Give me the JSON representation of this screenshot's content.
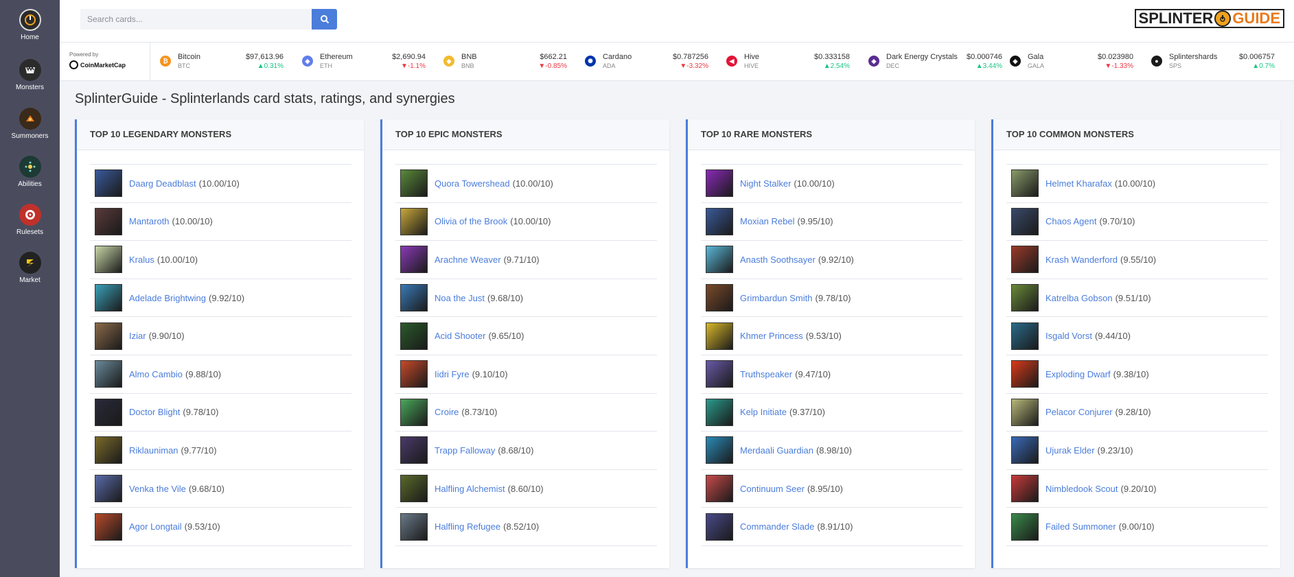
{
  "sidebar": {
    "items": [
      {
        "label": "Home",
        "icon": "home-icon",
        "color": "#2b2b2b"
      },
      {
        "label": "Monsters",
        "icon": "monster-icon",
        "color": "#2b2b2b"
      },
      {
        "label": "Summoners",
        "icon": "summoner-icon",
        "color": "#3a2a1a"
      },
      {
        "label": "Abilities",
        "icon": "abilities-icon",
        "color": "#1d3a35"
      },
      {
        "label": "Rulesets",
        "icon": "rulesets-icon",
        "color": "#c0312b"
      },
      {
        "label": "Market",
        "icon": "market-icon",
        "color": "#222222"
      }
    ]
  },
  "header": {
    "search_placeholder": "Search cards...",
    "logo_part1": "SPLINTER",
    "logo_part2": "GUIDE"
  },
  "ticker": {
    "powered_by": "Powered by",
    "provider": "CoinMarketCap",
    "coins": [
      {
        "name": "Bitcoin",
        "symbol": "BTC",
        "price": "$97,613.96",
        "change": "▲0.31%",
        "direction": "up",
        "color": "#f7931a",
        "glyph": "₿"
      },
      {
        "name": "Ethereum",
        "symbol": "ETH",
        "price": "$2,690.94",
        "change": "▼-1.1%",
        "direction": "down",
        "color": "#627eea",
        "glyph": "◆"
      },
      {
        "name": "BNB",
        "symbol": "BNB",
        "price": "$662.21",
        "change": "▼-0.85%",
        "direction": "down",
        "color": "#f3ba2f",
        "glyph": "◆"
      },
      {
        "name": "Cardano",
        "symbol": "ADA",
        "price": "$0.787256",
        "change": "▼-3.32%",
        "direction": "down",
        "color": "#0033ad",
        "glyph": "✺"
      },
      {
        "name": "Hive",
        "symbol": "HIVE",
        "price": "$0.333158",
        "change": "▲2.54%",
        "direction": "up",
        "color": "#e31337",
        "glyph": "◀"
      },
      {
        "name": "Dark Energy Crystals",
        "symbol": "DEC",
        "price": "$0.000746",
        "change": "▲3.44%",
        "direction": "up",
        "color": "#5a2d91",
        "glyph": "◆"
      },
      {
        "name": "Gala",
        "symbol": "GALA",
        "price": "$0.023980",
        "change": "▼-1.33%",
        "direction": "down",
        "color": "#111111",
        "glyph": "◈"
      },
      {
        "name": "Splintershards",
        "symbol": "SPS",
        "price": "$0.006757",
        "change": "▲0.7%",
        "direction": "up",
        "color": "#1a1a1a",
        "glyph": "●"
      }
    ]
  },
  "page": {
    "title": "SplinterGuide - Splinterlands card stats, ratings, and synergies"
  },
  "cards": [
    {
      "title": "TOP 10 LEGENDARY MONSTERS",
      "rows": [
        {
          "name": "Daarg Deadblast",
          "score": "(10.00/10)",
          "color": "#3a5a9a"
        },
        {
          "name": "Mantaroth",
          "score": "(10.00/10)",
          "color": "#5a3a3a"
        },
        {
          "name": "Kralus",
          "score": "(10.00/10)",
          "color": "#c9d6a8"
        },
        {
          "name": "Adelade Brightwing",
          "score": "(9.92/10)",
          "color": "#3aa0b8"
        },
        {
          "name": "Iziar",
          "score": "(9.90/10)",
          "color": "#8a6a4a"
        },
        {
          "name": "Almo Cambio",
          "score": "(9.88/10)",
          "color": "#6a8a9a"
        },
        {
          "name": "Doctor Blight",
          "score": "(9.78/10)",
          "color": "#2a2a3a"
        },
        {
          "name": "Riklauniman",
          "score": "(9.77/10)",
          "color": "#7a6a2a"
        },
        {
          "name": "Venka the Vile",
          "score": "(9.68/10)",
          "color": "#5a6aa8"
        },
        {
          "name": "Agor Longtail",
          "score": "(9.53/10)",
          "color": "#b84a2a"
        }
      ]
    },
    {
      "title": "TOP 10 EPIC MONSTERS",
      "rows": [
        {
          "name": "Quora Towershead",
          "score": "(10.00/10)",
          "color": "#5a8a3a"
        },
        {
          "name": "Olivia of the Brook",
          "score": "(10.00/10)",
          "color": "#c8a83a"
        },
        {
          "name": "Arachne Weaver",
          "score": "(9.71/10)",
          "color": "#8a3ab8"
        },
        {
          "name": "Noa the Just",
          "score": "(9.68/10)",
          "color": "#3a7ab8"
        },
        {
          "name": "Acid Shooter",
          "score": "(9.65/10)",
          "color": "#2a5a2a"
        },
        {
          "name": "Iidri Fyre",
          "score": "(9.10/10)",
          "color": "#c84a2a"
        },
        {
          "name": "Croire",
          "score": "(8.73/10)",
          "color": "#4aa85a"
        },
        {
          "name": "Trapp Falloway",
          "score": "(8.68/10)",
          "color": "#4a3a6a"
        },
        {
          "name": "Halfling Alchemist",
          "score": "(8.60/10)",
          "color": "#5a6a2a"
        },
        {
          "name": "Halfling Refugee",
          "score": "(8.52/10)",
          "color": "#6a7a8a"
        }
      ]
    },
    {
      "title": "TOP 10 RARE MONSTERS",
      "rows": [
        {
          "name": "Night Stalker",
          "score": "(10.00/10)",
          "color": "#8a2ab8"
        },
        {
          "name": "Moxian Rebel",
          "score": "(9.95/10)",
          "color": "#3a5a9a"
        },
        {
          "name": "Anasth Soothsayer",
          "score": "(9.92/10)",
          "color": "#5ab8d8"
        },
        {
          "name": "Grimbardun Smith",
          "score": "(9.78/10)",
          "color": "#7a4a2a"
        },
        {
          "name": "Khmer Princess",
          "score": "(9.53/10)",
          "color": "#d8b82a"
        },
        {
          "name": "Truthspeaker",
          "score": "(9.47/10)",
          "color": "#6a5aa8"
        },
        {
          "name": "Kelp Initiate",
          "score": "(9.37/10)",
          "color": "#2a9a8a"
        },
        {
          "name": "Merdaali Guardian",
          "score": "(8.98/10)",
          "color": "#2a8ab8"
        },
        {
          "name": "Continuum Seer",
          "score": "(8.95/10)",
          "color": "#c84a4a"
        },
        {
          "name": "Commander Slade",
          "score": "(8.91/10)",
          "color": "#4a4a8a"
        }
      ]
    },
    {
      "title": "TOP 10 COMMON MONSTERS",
      "rows": [
        {
          "name": "Helmet Kharafax",
          "score": "(10.00/10)",
          "color": "#8a9a6a"
        },
        {
          "name": "Chaos Agent",
          "score": "(9.70/10)",
          "color": "#3a4a6a"
        },
        {
          "name": "Krash Wanderford",
          "score": "(9.55/10)",
          "color": "#9a3a2a"
        },
        {
          "name": "Katrelba Gobson",
          "score": "(9.51/10)",
          "color": "#6a8a3a"
        },
        {
          "name": "Isgald Vorst",
          "score": "(9.44/10)",
          "color": "#2a6a8a"
        },
        {
          "name": "Exploding Dwarf",
          "score": "(9.38/10)",
          "color": "#d83a1a"
        },
        {
          "name": "Pelacor Conjurer",
          "score": "(9.28/10)",
          "color": "#b8b87a"
        },
        {
          "name": "Ujurak Elder",
          "score": "(9.23/10)",
          "color": "#3a6ab8"
        },
        {
          "name": "Nimbledook Scout",
          "score": "(9.20/10)",
          "color": "#c83a3a"
        },
        {
          "name": "Failed Summoner",
          "score": "(9.00/10)",
          "color": "#3a8a4a"
        }
      ]
    }
  ]
}
